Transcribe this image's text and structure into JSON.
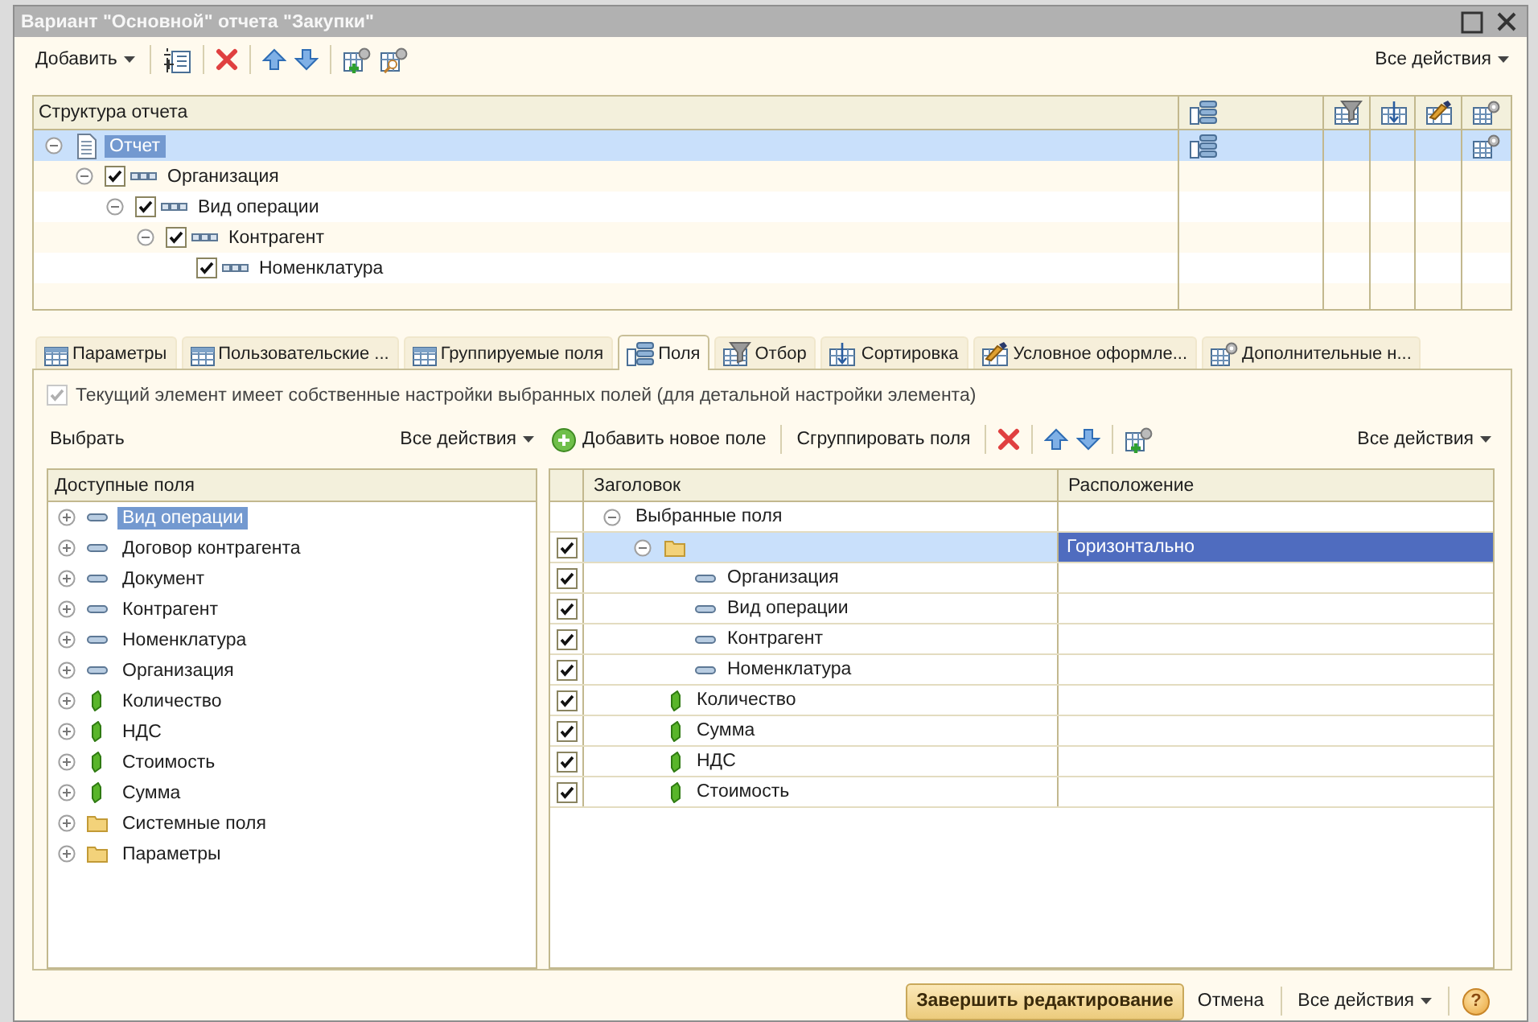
{
  "window": {
    "title": "Вариант \"Основной\" отчета \"Закупки\""
  },
  "toolbar": {
    "add": "Добавить",
    "all_actions": "Все действия"
  },
  "structure": {
    "header": "Структура отчета",
    "root": {
      "kind": "report",
      "label": "Отчет",
      "selected": true,
      "expanded": true,
      "children": [
        {
          "kind": "grouping",
          "label": "Организация",
          "checked": true,
          "selected": false,
          "expanded": true,
          "children": [
            {
              "kind": "grouping",
              "label": "Вид операции",
              "checked": true,
              "selected": false,
              "expanded": true,
              "children": [
                {
                  "kind": "grouping",
                  "label": "Контрагент",
                  "checked": true,
                  "selected": false,
                  "expanded": true,
                  "children": [
                    {
                      "kind": "grouping",
                      "label": "Номенклатура",
                      "checked": true,
                      "selected": false
                    }
                  ]
                }
              ]
            }
          ]
        }
      ]
    }
  },
  "tabs": [
    {
      "label": "Параметры",
      "selected": false
    },
    {
      "label": "Пользовательские ...",
      "selected": false
    },
    {
      "label": "Группируемые поля",
      "selected": false
    },
    {
      "label": "Поля",
      "selected": true
    },
    {
      "label": "Отбор",
      "selected": false
    },
    {
      "label": "Сортировка",
      "selected": false
    },
    {
      "label": "Условное оформле...",
      "selected": false
    },
    {
      "label": "Дополнительные н...",
      "selected": false
    }
  ],
  "panel": {
    "own_settings": {
      "label": "Текущий элемент имеет собственные настройки выбранных полей (для детальной настройки элемента)",
      "checked": true,
      "disabled": true
    },
    "left_toolbar": {
      "select": "Выбрать",
      "all_actions": "Все действия"
    },
    "right_toolbar": {
      "add_field": "Добавить новое поле",
      "group_fields": "Сгруппировать поля",
      "all_actions": "Все действия"
    },
    "available_fields": {
      "header": "Доступные поля",
      "items": [
        {
          "kind": "dimension",
          "label": "Вид операции",
          "selected": true,
          "expanded": false
        },
        {
          "kind": "dimension",
          "label": "Договор контрагента",
          "selected": false,
          "expanded": false
        },
        {
          "kind": "dimension",
          "label": "Документ",
          "selected": false,
          "expanded": false
        },
        {
          "kind": "dimension",
          "label": "Контрагент",
          "selected": false,
          "expanded": false
        },
        {
          "kind": "dimension",
          "label": "Номенклатура",
          "selected": false,
          "expanded": false
        },
        {
          "kind": "dimension",
          "label": "Организация",
          "selected": false,
          "expanded": false
        },
        {
          "kind": "resource",
          "label": "Количество",
          "selected": false,
          "expanded": false
        },
        {
          "kind": "resource",
          "label": "НДС",
          "selected": false,
          "expanded": false
        },
        {
          "kind": "resource",
          "label": "Стоимость",
          "selected": false,
          "expanded": false
        },
        {
          "kind": "resource",
          "label": "Сумма",
          "selected": false,
          "expanded": false
        },
        {
          "kind": "folder",
          "label": "Системные поля",
          "selected": false,
          "expanded": false
        },
        {
          "kind": "folder",
          "label": "Параметры",
          "selected": false,
          "expanded": false
        }
      ]
    },
    "selected_fields": {
      "columns": [
        "Заголовок",
        "Расположение"
      ],
      "root": {
        "label": "Выбранные поля",
        "expanded": true,
        "children": [
          {
            "kind": "group",
            "placement": "Горизонтально",
            "checked": true,
            "selected": true,
            "expanded": true,
            "children": [
              {
                "kind": "dimension",
                "label": "Организация",
                "checked": true,
                "selected": false
              },
              {
                "kind": "dimension",
                "label": "Вид операции",
                "checked": true,
                "selected": false
              },
              {
                "kind": "dimension",
                "label": "Контрагент",
                "checked": true,
                "selected": false
              },
              {
                "kind": "dimension",
                "label": "Номенклатура",
                "checked": true,
                "selected": false
              }
            ]
          },
          {
            "kind": "resource",
            "label": "Количество",
            "checked": true,
            "selected": false
          },
          {
            "kind": "resource",
            "label": "Сумма",
            "checked": true,
            "selected": false
          },
          {
            "kind": "resource",
            "label": "НДС",
            "checked": true,
            "selected": false
          },
          {
            "kind": "resource",
            "label": "Стоимость",
            "checked": true,
            "selected": false
          }
        ]
      }
    }
  },
  "footer": {
    "finish": "Завершить редактирование",
    "cancel": "Отмена",
    "all_actions": "Все действия",
    "help": "?"
  }
}
